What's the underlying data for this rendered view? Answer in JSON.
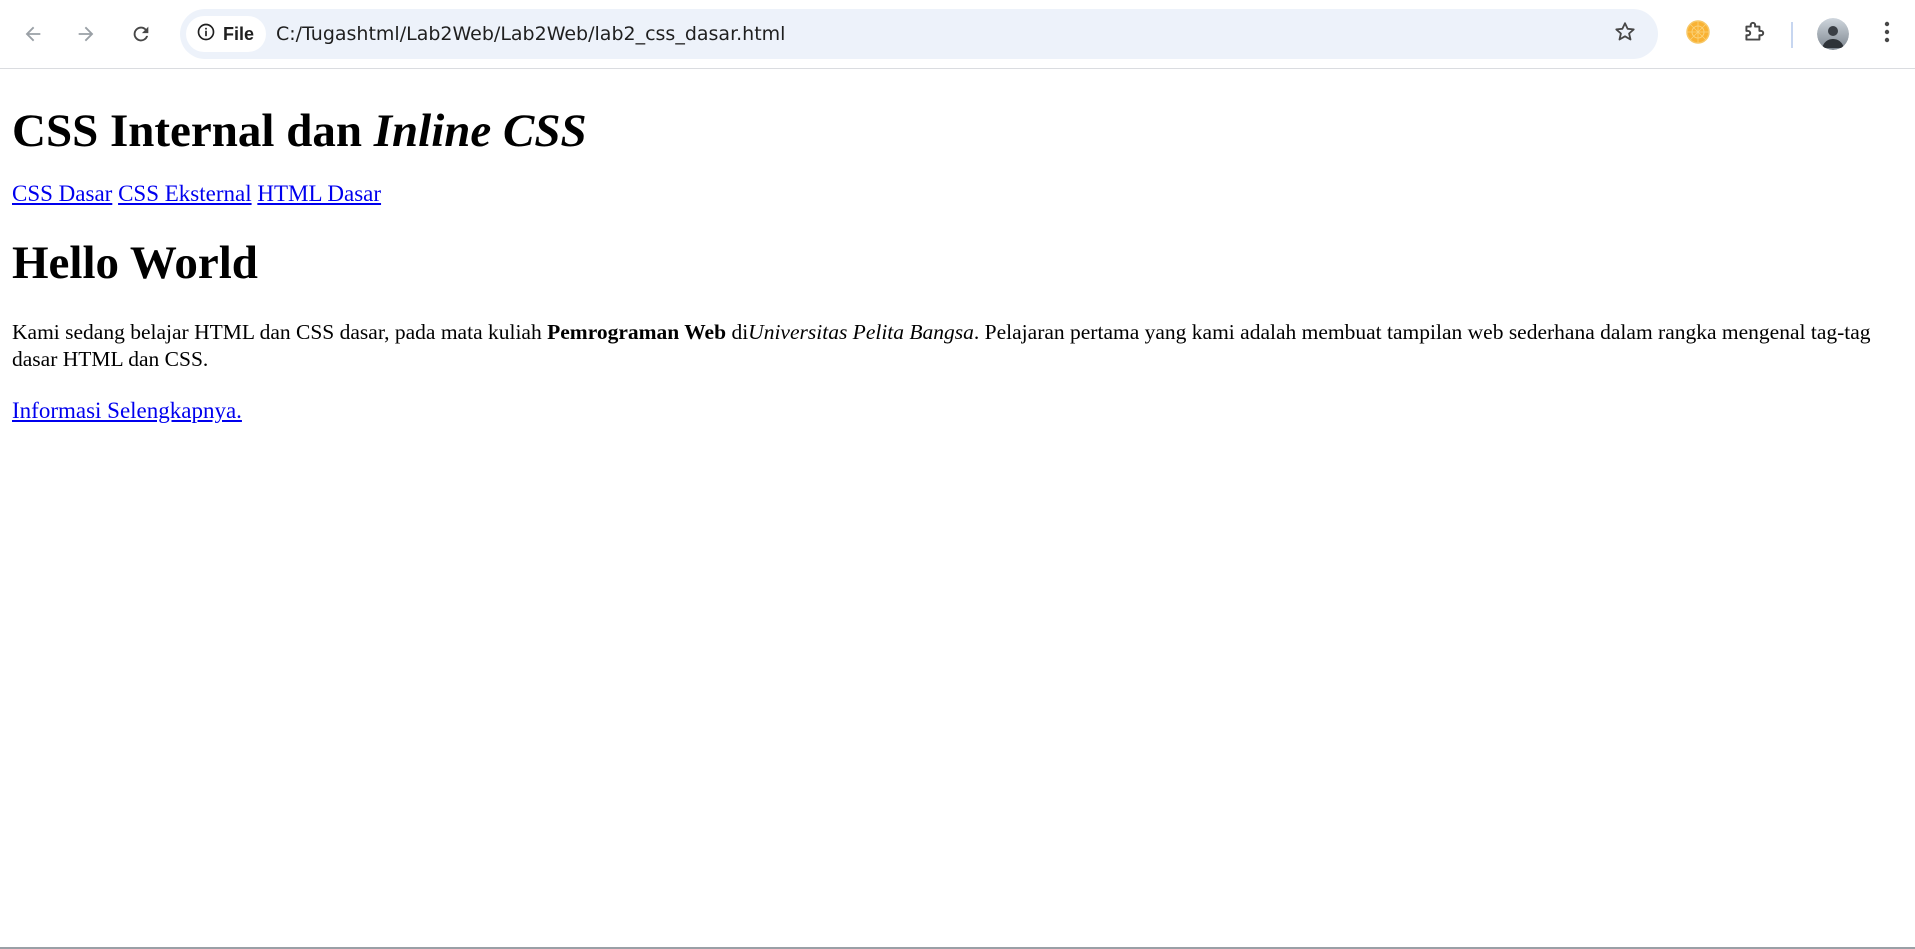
{
  "browser": {
    "site_chip_label": "File",
    "url": "C:/Tugashtml/Lab2Web/Lab2Web/lab2_css_dasar.html",
    "icons": {
      "back": "arrow-left-icon",
      "forward": "arrow-right-icon",
      "reload": "reload-icon",
      "site_info": "info-circle-icon",
      "bookmark": "star-icon",
      "extension_1": "orange-circle-extension-icon",
      "extensions": "puzzle-icon",
      "profile": "avatar",
      "menu": "kebab-menu-icon"
    },
    "colors": {
      "omnibox_bg": "#edf2fa",
      "link": "#0000ee",
      "extension_orange": "#f9b233"
    }
  },
  "page": {
    "title_plain": "CSS Internal dan ",
    "title_italic": "Inline CSS",
    "nav_links": [
      {
        "label": "CSS Dasar"
      },
      {
        "label": "CSS Eksternal"
      },
      {
        "label": "HTML Dasar"
      }
    ],
    "heading": "Hello World",
    "intro": {
      "part1": "Kami sedang belajar HTML dan CSS dasar, pada mata kuliah ",
      "bold": "Pemrograman Web",
      "part2": " di",
      "italic": "Universitas Pelita Bangsa",
      "part3": ". Pelajaran pertama yang kami adalah membuat tampilan web sederhana dalam rangka mengenal tag-tag dasar HTML dan CSS."
    },
    "more_link": "Informasi Selengkapnya."
  }
}
